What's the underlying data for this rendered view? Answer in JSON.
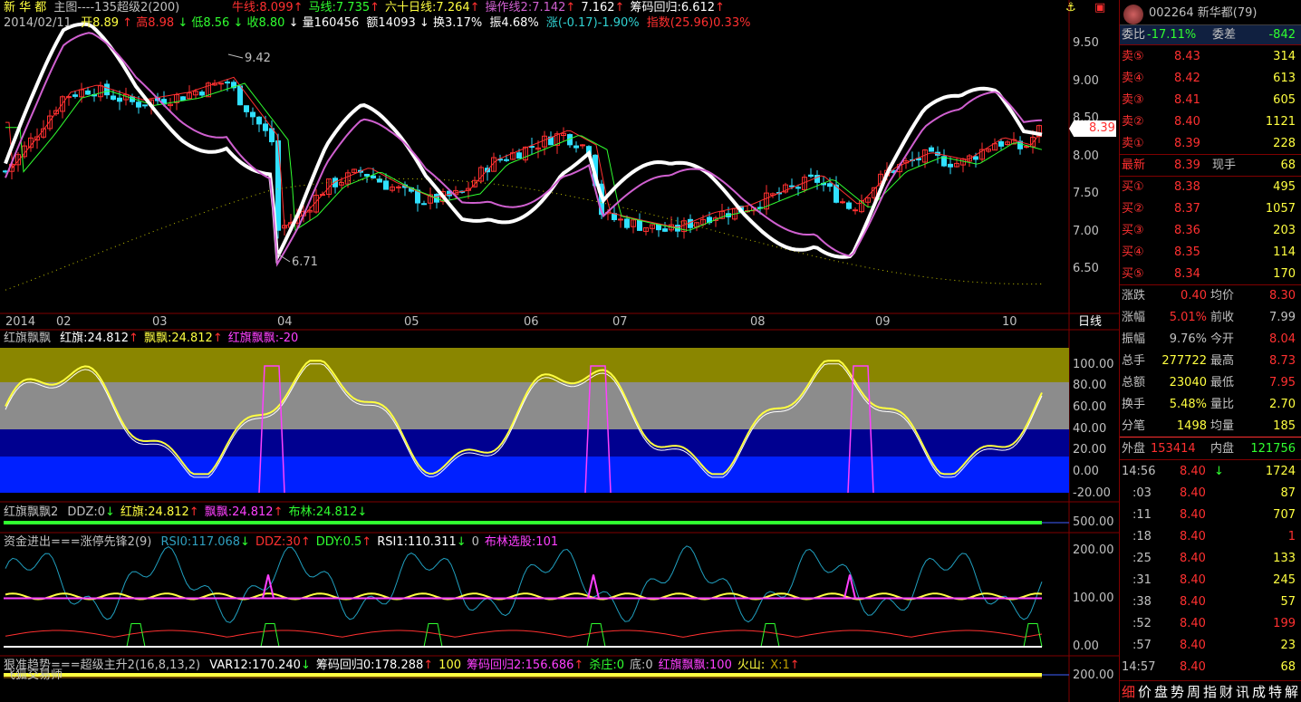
{
  "header": {
    "stock_name": "新 华 都",
    "main_label": "主图----135超级2(200)",
    "ma_items": [
      {
        "label": "牛线:8.099",
        "color": "#ff3030",
        "arrow": "↑"
      },
      {
        "label": "马线:7.735",
        "color": "#30ff30",
        "arrow": "↑"
      },
      {
        "label": "六十日线:7.264",
        "color": "#ffff40",
        "arrow": "↑"
      },
      {
        "label": "操作线2:7.142",
        "color": "#d060d0",
        "arrow": "↑"
      },
      {
        "label": "7.162",
        "color": "#ffffff",
        "arrow": "↑"
      },
      {
        "label": "筹码回归:6.612",
        "color": "#ffffff",
        "arrow": "↑"
      }
    ],
    "date": "2014/02/11",
    "open": "开8.89",
    "high": "高8.98",
    "low": "低8.56",
    "close": "收8.80",
    "volume": "量160456",
    "amount": "额14093",
    "turnover": "换3.17%",
    "amplitude": "振4.68%",
    "change": "涨(-0.17)-1.90%",
    "index": "指数(25.96)0.33%"
  },
  "price_axis": [
    "9.50",
    "9.00",
    "8.50",
    "8.00",
    "7.50",
    "7.00",
    "6.50"
  ],
  "price_annotations": {
    "high": "9.42",
    "low": "6.71"
  },
  "current_price_tag": "8.39",
  "months": [
    "2014",
    "02",
    "03",
    "04",
    "05",
    "06",
    "07",
    "08",
    "09",
    "10"
  ],
  "period_label": "日线",
  "panel2": {
    "title": "红旗飘飘",
    "items": [
      {
        "label": "红旗:24.812",
        "color": "#ffffff",
        "arrow": "↑"
      },
      {
        "label": "飘飘:24.812",
        "color": "#ffff40",
        "arrow": "↑"
      },
      {
        "label": "红旗飘飘:-20",
        "color": "#ff40ff",
        "arrow": ""
      }
    ],
    "axis": [
      "100.00",
      "80.00",
      "60.00",
      "40.00",
      "20.00",
      "0.00",
      "-20.00"
    ]
  },
  "panel3": {
    "title": "红旗飘飘2",
    "items": [
      {
        "label": "DDZ:0",
        "color": "#c0c0c0",
        "arrow": "↓"
      },
      {
        "label": "红旗:24.812",
        "color": "#ffff40",
        "arrow": "↑"
      },
      {
        "label": "飘飘:24.812",
        "color": "#ff40ff",
        "arrow": "↑"
      },
      {
        "label": "布林:24.812",
        "color": "#30ff30",
        "arrow": "↓"
      }
    ],
    "axis": [
      "500.00"
    ]
  },
  "panel4": {
    "title": "资金进出===涨停先锋2(9)",
    "items": [
      {
        "label": "RSI0:117.068",
        "color": "#30a0c0",
        "arrow": "↓"
      },
      {
        "label": "DDZ:30",
        "color": "#ff3030",
        "arrow": "↑"
      },
      {
        "label": "DDY:0.5",
        "color": "#30ff30",
        "arrow": "↑"
      },
      {
        "label": "RSI1:110.311",
        "color": "#ffffff",
        "arrow": "↓"
      },
      {
        "label": "0",
        "color": "#c0c0c0",
        "arrow": ""
      },
      {
        "label": "布林选股:101",
        "color": "#ff40ff",
        "arrow": ""
      }
    ],
    "axis": [
      "200.00",
      "100.00",
      "0.00"
    ]
  },
  "panel5": {
    "title": "狠准趋势===超级主升2(16,8,13,2)",
    "items": [
      {
        "label": "VAR12:170.240",
        "color": "#ffffff",
        "arrow": "↓"
      },
      {
        "label": "筹码回归0:178.288",
        "color": "#ffffff",
        "arrow": "↑"
      },
      {
        "label": "100",
        "color": "#ffff40",
        "arrow": ""
      },
      {
        "label": "筹码回归2:156.686",
        "color": "#ff40ff",
        "arrow": "↑"
      },
      {
        "label": "杀庄:0",
        "color": "#30ff30",
        "arrow": ""
      },
      {
        "label": "底:0",
        "color": "#c0c0c0",
        "arrow": ""
      },
      {
        "label": "红旗飘飘:100",
        "color": "#ff40ff",
        "arrow": ""
      },
      {
        "label": "火山:",
        "color": "#ffff40",
        "arrow": ""
      },
      {
        "label": "X:1",
        "color": "#c0a000",
        "arrow": "↑"
      }
    ],
    "axis": [
      "200.00"
    ],
    "watermark": "飞狐交易师"
  },
  "quote": {
    "code_name": "002264 新华都(79)",
    "weibi_label": "委比",
    "weibi_value": "-17.11%",
    "weicha_label": "委差",
    "weicha_value": "-842",
    "sells": [
      {
        "label": "卖⑤",
        "price": "8.43",
        "vol": "314"
      },
      {
        "label": "卖④",
        "price": "8.42",
        "vol": "613"
      },
      {
        "label": "卖③",
        "price": "8.41",
        "vol": "605"
      },
      {
        "label": "卖②",
        "price": "8.40",
        "vol": "1121"
      },
      {
        "label": "卖①",
        "price": "8.39",
        "vol": "228"
      }
    ],
    "latest_label": "最新",
    "latest_value": "8.39",
    "xianshou_label": "现手",
    "xianshou_value": "68",
    "buys": [
      {
        "label": "买①",
        "price": "8.38",
        "vol": "495"
      },
      {
        "label": "买②",
        "price": "8.37",
        "vol": "1057"
      },
      {
        "label": "买③",
        "price": "8.36",
        "vol": "203"
      },
      {
        "label": "买④",
        "price": "8.35",
        "vol": "114"
      },
      {
        "label": "买⑤",
        "price": "8.34",
        "vol": "170"
      }
    ],
    "stats": [
      {
        "l1": "涨跌",
        "v1": "0.40",
        "l2": "均价",
        "v2": "8.30",
        "c1": "#ff3030",
        "c2": "#ff3030"
      },
      {
        "l1": "涨幅",
        "v1": "5.01%",
        "l2": "前收",
        "v2": "7.99",
        "c1": "#ff3030",
        "c2": "#c0c0c0"
      },
      {
        "l1": "振幅",
        "v1": "9.76%",
        "l2": "今开",
        "v2": "8.04",
        "c1": "#c0c0c0",
        "c2": "#ff3030"
      },
      {
        "l1": "总手",
        "v1": "277722",
        "l2": "最高",
        "v2": "8.73",
        "c1": "#ffff40",
        "c2": "#ff3030"
      },
      {
        "l1": "总额",
        "v1": "23040",
        "l2": "最低",
        "v2": "7.95",
        "c1": "#ffff40",
        "c2": "#ff3030"
      },
      {
        "l1": "换手",
        "v1": "5.48%",
        "l2": "量比",
        "v2": "2.70",
        "c1": "#ffff40",
        "c2": "#ffff40"
      },
      {
        "l1": "分笔",
        "v1": "1498",
        "l2": "均量",
        "v2": "185",
        "c1": "#ffff40",
        "c2": "#ffff40"
      }
    ],
    "outer_label": "外盘",
    "outer_value": "153414",
    "inner_label": "内盘",
    "inner_value": "121756",
    "ticks": [
      {
        "time": "14:56",
        "price": "8.40",
        "arrow": "↓",
        "vol": "1724"
      },
      {
        "time": ":03",
        "price": "8.40",
        "arrow": "",
        "vol": "87"
      },
      {
        "time": ":11",
        "price": "8.40",
        "arrow": "",
        "vol": "707"
      },
      {
        "time": ":18",
        "price": "8.40",
        "arrow": "",
        "vol": "1"
      },
      {
        "time": ":25",
        "price": "8.40",
        "arrow": "",
        "vol": "133"
      },
      {
        "time": ":31",
        "price": "8.40",
        "arrow": "",
        "vol": "245"
      },
      {
        "time": ":38",
        "price": "8.40",
        "arrow": "",
        "vol": "57"
      },
      {
        "time": ":52",
        "price": "8.40",
        "arrow": "",
        "vol": "199"
      },
      {
        "time": ":57",
        "price": "8.40",
        "arrow": "",
        "vol": "23"
      },
      {
        "time": "14:57",
        "price": "8.40",
        "arrow": "",
        "vol": "68"
      }
    ],
    "bottom_tabs": [
      "细",
      "价",
      "盘",
      "势",
      "周",
      "指",
      "财",
      "讯",
      "成",
      "特",
      "解"
    ]
  },
  "chart_data": {
    "type": "line",
    "series": [],
    "ylim": [
      6.4,
      9.7
    ],
    "note_axis": "price"
  }
}
